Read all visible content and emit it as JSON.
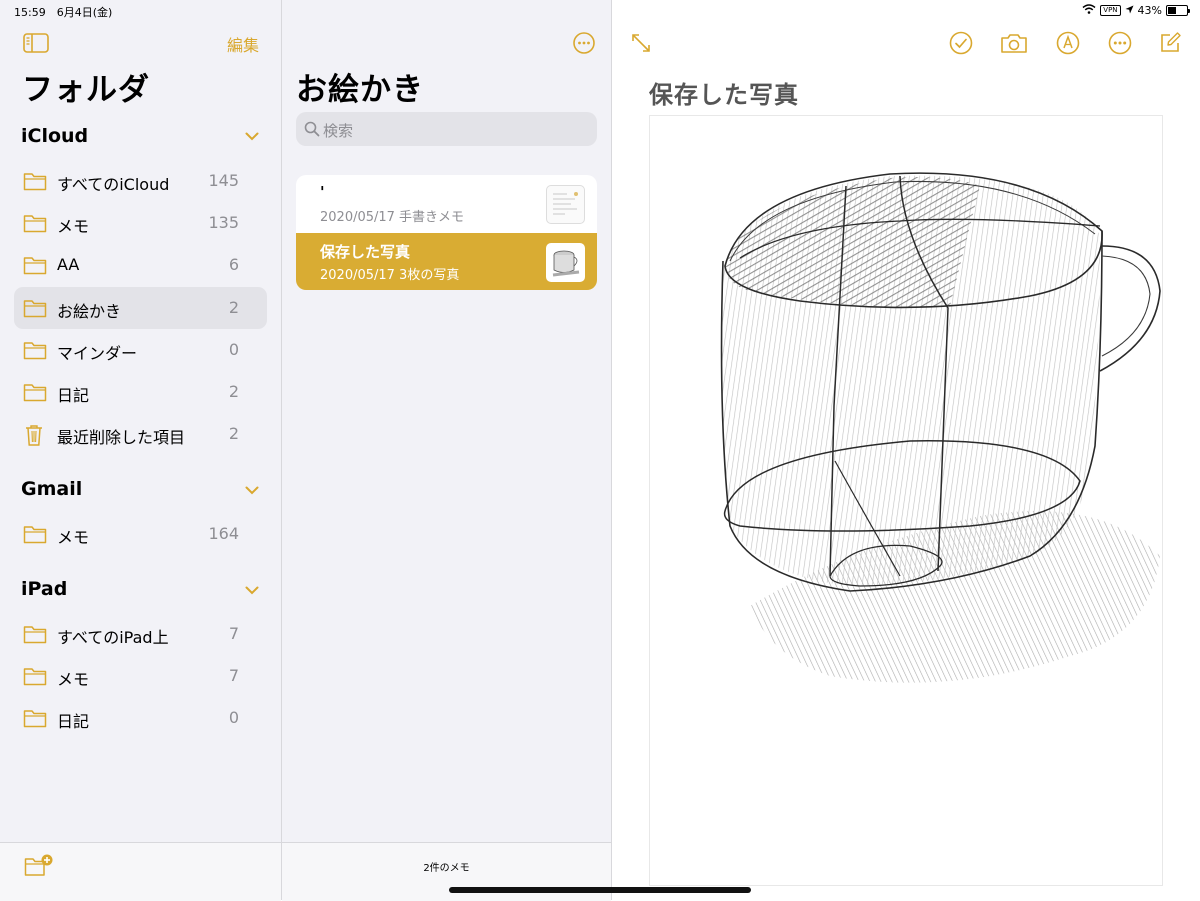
{
  "status_bar": {
    "time_date": "15:59　6月4日(金)",
    "vpn": "VPN",
    "battery_percent": "43%",
    "battery_level": 0.43
  },
  "colors": {
    "accent": "#d9a82f",
    "selected_note": "#d9ac33",
    "sidebar_bg": "#f2f2f7"
  },
  "sidebar": {
    "edit_label": "編集",
    "title": "フォルダ",
    "sections": [
      {
        "name": "iCloud",
        "folders": [
          {
            "name": "すべてのiCloud",
            "count": "145",
            "icon": "folder-icon"
          },
          {
            "name": "メモ",
            "count": "135",
            "icon": "folder-icon"
          },
          {
            "name": "AA",
            "count": "6",
            "icon": "folder-icon"
          },
          {
            "name": "お絵かき",
            "count": "2",
            "icon": "folder-icon",
            "selected": true
          },
          {
            "name": "マインダー",
            "count": "0",
            "icon": "folder-icon"
          },
          {
            "name": "日記",
            "count": "2",
            "icon": "folder-icon"
          },
          {
            "name": "最近削除した項目",
            "count": "2",
            "icon": "trash-icon"
          }
        ]
      },
      {
        "name": "Gmail",
        "folders": [
          {
            "name": "メモ",
            "count": "164",
            "icon": "folder-icon"
          }
        ]
      },
      {
        "name": "iPad",
        "folders": [
          {
            "name": "すべてのiPad上",
            "count": "7",
            "icon": "folder-icon"
          },
          {
            "name": "メモ",
            "count": "7",
            "icon": "folder-icon"
          },
          {
            "name": "日記",
            "count": "0",
            "icon": "folder-icon"
          }
        ]
      }
    ]
  },
  "note_list": {
    "title": "お絵かき",
    "search_placeholder": "検索",
    "notes": [
      {
        "title": "'",
        "meta": "2020/05/17  手書きメモ"
      },
      {
        "title": "保存した写真",
        "meta": "2020/05/17  3枚の写真",
        "selected": true
      }
    ],
    "count_label": "2件のメモ"
  },
  "detail": {
    "note_title": "保存した写真",
    "toolbar_icons": [
      "expand-icon",
      "checklist-icon",
      "camera-icon",
      "markup-icon",
      "more-icon",
      "compose-icon"
    ]
  }
}
